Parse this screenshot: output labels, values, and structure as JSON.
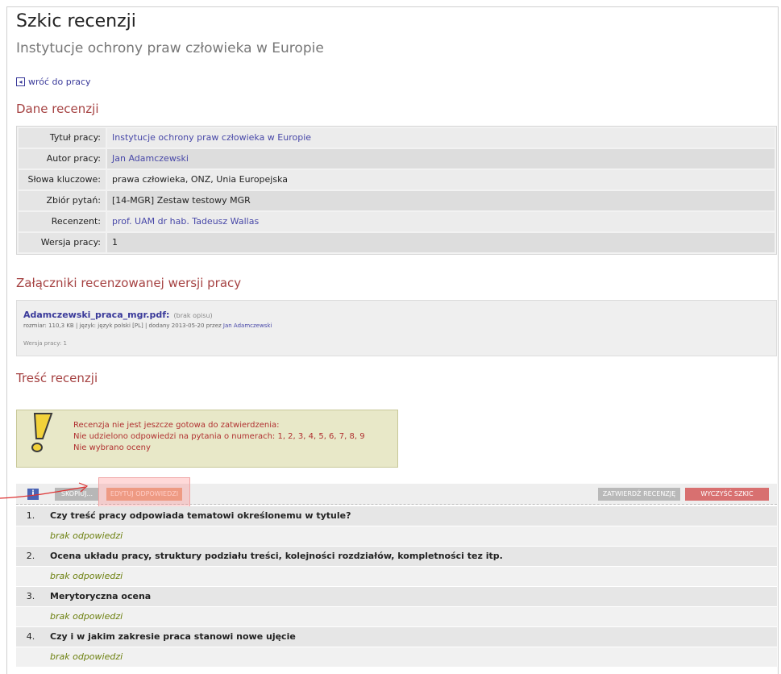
{
  "page": {
    "title": "Szkic recenzji",
    "subtitle": "Instytucje ochrony praw człowieka w Europie",
    "back_link": "wróć do pracy"
  },
  "sections": {
    "review_data": "Dane recenzji",
    "attachments": "Załączniki recenzowanej wersji pracy",
    "content": "Treść recenzji"
  },
  "info_rows": [
    {
      "label": "Tytuł pracy:",
      "value": "Instytucje ochrony praw człowieka w Europie"
    },
    {
      "label": "Autor pracy:",
      "value": "Jan Adamczewski"
    },
    {
      "label": "Słowa kluczowe:",
      "value": "prawa człowieka, ONZ, Unia Europejska"
    },
    {
      "label": "Zbiór pytań:",
      "value": "[14-MGR] Zestaw testowy MGR"
    },
    {
      "label": "Recenzent:",
      "value": "prof. UAM dr hab. Tadeusz Wallas"
    },
    {
      "label": "Wersja pracy:",
      "value": "1"
    }
  ],
  "attachment": {
    "filename": "Adamczewski_praca_mgr.pdf:",
    "description": "(brak opisu)",
    "meta_prefix": "rozmiar: 110,3 KB | język: język polski [PL] | dodany 2013-05-20 przez",
    "added_by": "Jan Adamczewski",
    "version": "Wersja pracy: 1"
  },
  "warning": {
    "line1": "Recenzja nie jest jeszcze gotowa do zatwierdzenia:",
    "line2": "Nie udzielono odpowiedzi na pytania o numerach: 1, 2, 3, 4, 5, 6, 7, 8, 9",
    "line3": "Nie wybrano oceny"
  },
  "toolbar": {
    "info_icon": "i",
    "skonto_label": "SKOPIUJ...",
    "edit_label": "EDYTUJ ODPOWIEDZI",
    "approve_label": "ZATWIERDŹ RECENZJĘ",
    "clear_label": "WYCZYŚĆ SZKIC"
  },
  "questions": [
    {
      "num": "1.",
      "text": "Czy treść pracy odpowiada tematowi określonemu w tytule?",
      "answer": "brak odpowiedzi"
    },
    {
      "num": "2.",
      "text": "Ocena układu pracy, struktury podziału treści, kolejności rozdziałów, kompletności tez itp.",
      "answer": "brak odpowiedzi"
    },
    {
      "num": "3.",
      "text": "Merytoryczna ocena",
      "answer": "brak odpowiedzi"
    },
    {
      "num": "4.",
      "text": "Czy i w jakim zakresie praca stanowi nowe ujęcie",
      "answer": "brak odpowiedzi"
    }
  ],
  "colors": {
    "section_title": "#a54141",
    "link": "#4848a8",
    "answer_text": "#6b7f0d",
    "clear_button": "#d87070",
    "edit_button": "#e8a888"
  }
}
